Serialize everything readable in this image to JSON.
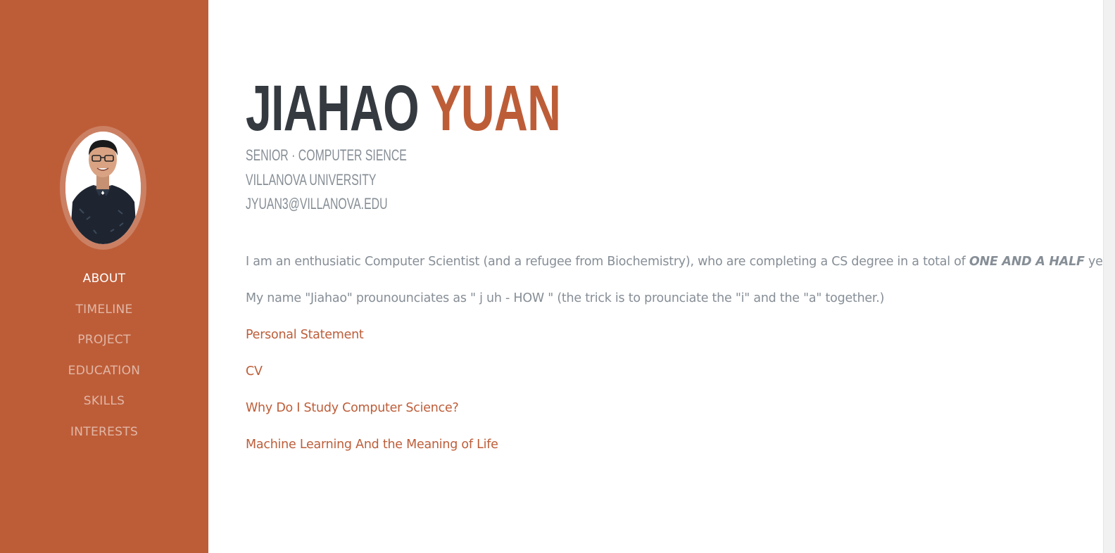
{
  "profile": {
    "photo_alt": "profile-photo"
  },
  "nav": {
    "items": [
      {
        "label": "ABOUT"
      },
      {
        "label": "TIMELINE"
      },
      {
        "label": "PROJECT"
      },
      {
        "label": "EDUCATION"
      },
      {
        "label": "SKILLS"
      },
      {
        "label": "INTERESTS"
      }
    ],
    "active": "ABOUT"
  },
  "about": {
    "first_name": "JIAHAO",
    "last_name": "YUAN",
    "subheadings": [
      "SENIOR · COMPUTER SIENCE",
      "VILLANOVA UNIVERSITY",
      "JYUAN3@VILLANOVA.EDU"
    ],
    "intro": {
      "before": "I am an enthusiatic Computer Scientist (and a refugee from Biochemistry), who are completing a CS degree in a total of ",
      "emphasis": "ONE AND A HALF",
      "after": " years."
    },
    "pronunciation": "My name \"Jiahao\" prounounciates as \" j uh - HOW \" (the trick is to prounciate the \"i\" and the \"a\" together.)",
    "links": [
      {
        "label": "Personal Statement"
      },
      {
        "label": "CV"
      },
      {
        "label": "Why Do I Study Computer Science?"
      },
      {
        "label": "Machine Learning And the Meaning of Life"
      }
    ]
  },
  "colors": {
    "primary": "#bd5d38",
    "heading": "#343a40",
    "muted": "#868e96"
  }
}
